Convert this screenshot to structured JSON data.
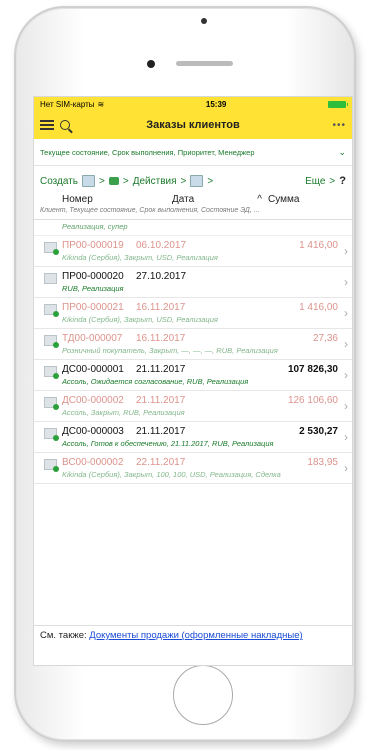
{
  "status": {
    "carrier": "Нет SIM-карты",
    "time": "15:39"
  },
  "header": {
    "title": "Заказы клиентов",
    "more": "•••"
  },
  "filter": {
    "text": "Текущее состояние, Срок выполнения, Приоритет, Менеджер"
  },
  "toolbar": {
    "create": "Создать",
    "actions": "Действия",
    "more": "Еще",
    "help": "?",
    "gt": ">"
  },
  "columns": {
    "number": "Номер",
    "date": "Дата",
    "sort": "^",
    "sum": "Сумма",
    "subtitle": "Клиент, Текущее состояние, Срок выполнения, Состояние ЭД, ..."
  },
  "first_row_tail": "Реализация, супер",
  "rows": [
    {
      "num": "ПР00-000019",
      "date": "06.10.2017",
      "sum": "1 416,00",
      "desc": "Kikinda (Сербия), Закрыт, USD, Реализация"
    },
    {
      "num": "ПР00-000020",
      "date": "27.10.2017",
      "sum": "",
      "desc": "RUB, Реализация"
    },
    {
      "num": "ПР00-000021",
      "date": "16.11.2017",
      "sum": "1 416,00",
      "desc": "Kikinda (Сербия), Закрыт, USD, Реализация"
    },
    {
      "num": "ТД00-000007",
      "date": "16.11.2017",
      "sum": "27,36",
      "desc": "Розничный покупатель, Закрыт, —, —, —, RUB, Реализация"
    },
    {
      "num": "ДС00-000001",
      "date": "21.11.2017",
      "sum": "107 826,30",
      "desc": "Ассоль, Ожидается согласование, RUB, Реализация"
    },
    {
      "num": "ДС00-000002",
      "date": "21.11.2017",
      "sum": "126 106,60",
      "desc": "Ассоль, Закрыт, RUB, Реализация"
    },
    {
      "num": "ДС00-000003",
      "date": "21.11.2017",
      "sum": "2 530,27",
      "desc": "Ассоль, Готов к обеспечению, 21.11.2017, RUB, Реализация"
    },
    {
      "num": "ВС00-000002",
      "date": "22.11.2017",
      "sum": "183,95",
      "desc": "Kikinda (Сербия), Закрыт, 100, 100, USD, Реализация, Сделка"
    }
  ],
  "footer": {
    "prefix": "См. также:",
    "link": "Документы продажи (оформленные накладные)"
  }
}
